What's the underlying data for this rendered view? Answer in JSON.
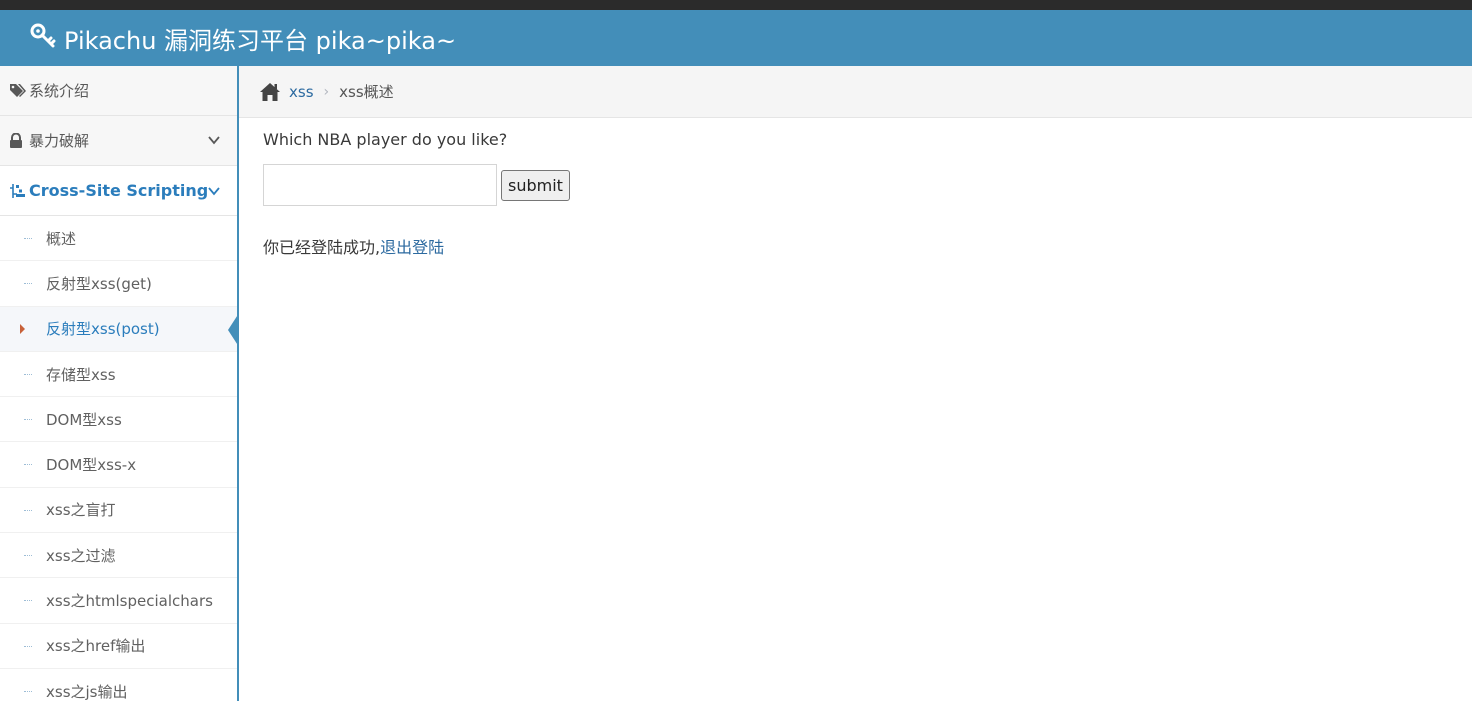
{
  "navbar": {
    "brand": "Pikachu 漏洞练习平台 pika~pika~"
  },
  "sidebar": {
    "items": [
      {
        "label": "系统介绍"
      },
      {
        "label": "暴力破解"
      },
      {
        "label": "Cross-Site Scripting"
      }
    ],
    "xss_submenu": [
      {
        "label": "概述"
      },
      {
        "label": "反射型xss(get)"
      },
      {
        "label": "反射型xss(post)"
      },
      {
        "label": "存储型xss"
      },
      {
        "label": "DOM型xss"
      },
      {
        "label": "DOM型xss-x"
      },
      {
        "label": "xss之盲打"
      },
      {
        "label": "xss之过滤"
      },
      {
        "label": "xss之htmlspecialchars"
      },
      {
        "label": "xss之href输出"
      },
      {
        "label": "xss之js输出"
      }
    ]
  },
  "breadcrumb": {
    "parent": "xss",
    "separator": "›",
    "current": "xss概述"
  },
  "main": {
    "question": "Which NBA player do you like?",
    "input_value": "",
    "submit_label": "submit",
    "login_message": "你已经登陆成功,",
    "logout_link": "退出登陆"
  },
  "colors": {
    "navbar": "#438eb9",
    "link": "#2c6aa0",
    "active": "#2b7dbc",
    "caret": "#c86139"
  }
}
